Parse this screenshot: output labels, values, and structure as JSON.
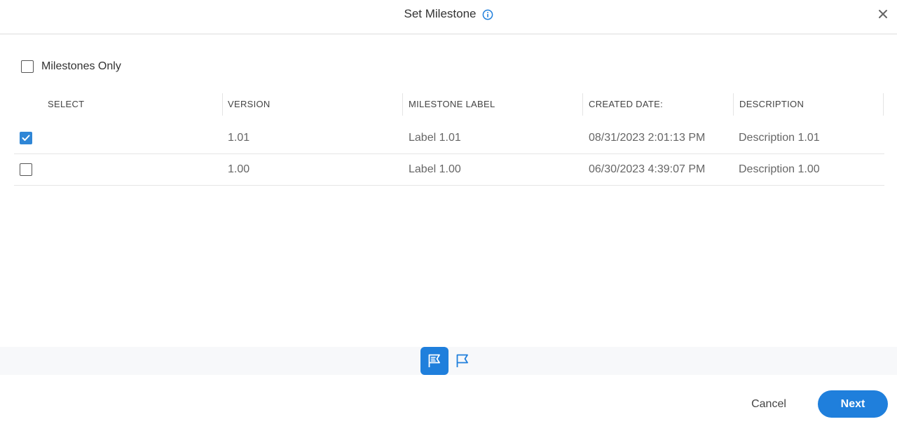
{
  "dialog": {
    "title": "Set Milestone",
    "info_icon": "info-icon",
    "close_icon": "close-icon"
  },
  "filter": {
    "milestones_only_label": "Milestones Only",
    "milestones_only_checked": false
  },
  "table": {
    "columns": [
      "SELECT",
      "VERSION",
      "MILESTONE LABEL",
      "CREATED DATE:",
      "DESCRIPTION"
    ],
    "rows": [
      {
        "selected": true,
        "version": "1.01",
        "label": "Label 1.01",
        "created": "08/31/2023 2:01:13 PM",
        "description": "Description 1.01"
      },
      {
        "selected": false,
        "version": "1.00",
        "label": "Label 1.00",
        "created": "06/30/2023 4:39:07 PM",
        "description": "Description 1.00"
      }
    ]
  },
  "toolbar": {
    "items": [
      {
        "icon": "flag-list-icon",
        "active": true
      },
      {
        "icon": "flag-icon",
        "active": false
      }
    ]
  },
  "footer": {
    "cancel_label": "Cancel",
    "next_label": "Next"
  },
  "colors": {
    "accent": "#1f7fdc",
    "checkbox_checked": "#2f86d6"
  }
}
